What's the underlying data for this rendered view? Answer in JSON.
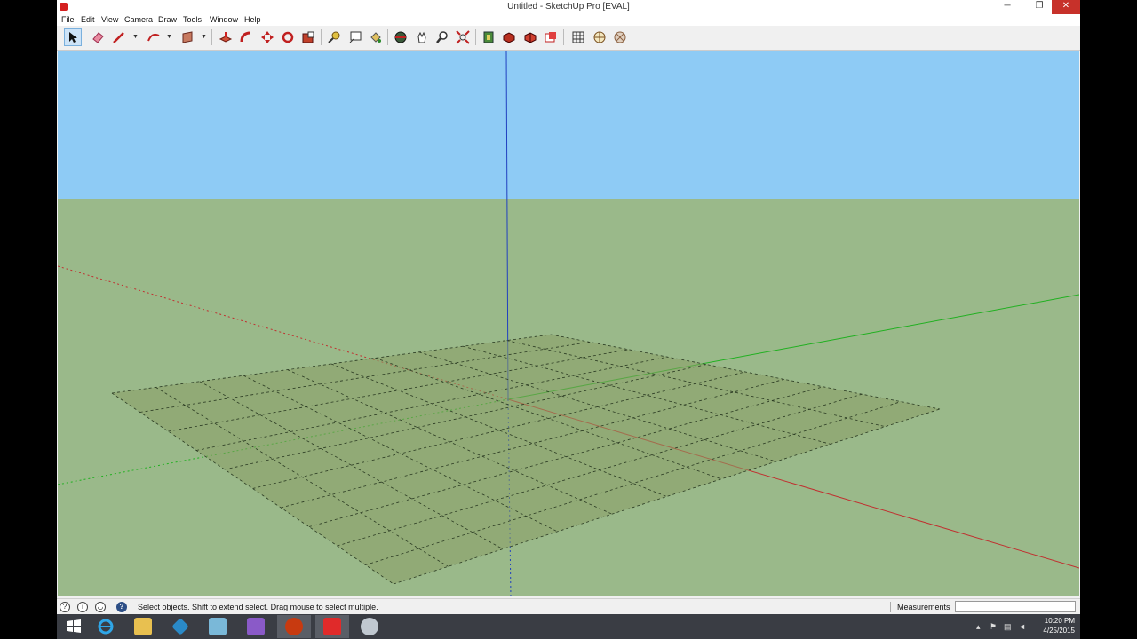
{
  "window": {
    "title": "Untitled - SketchUp Pro [EVAL]",
    "minimize_glyph": "─",
    "maximize_glyph": "❐",
    "close_glyph": "✕"
  },
  "menu": [
    "File",
    "Edit",
    "View",
    "Camera",
    "Draw",
    "Tools",
    "Window",
    "Help"
  ],
  "toolbar": {
    "tools": [
      "select-icon",
      "eraser-icon",
      "line-icon",
      "arc-icon",
      "rectangle-icon",
      "push-pull-icon",
      "follow-me-icon",
      "move-icon",
      "rotate-icon",
      "scale-icon",
      "tape-measure-icon",
      "text-icon",
      "paint-bucket-icon",
      "orbit-icon",
      "pan-icon",
      "zoom-icon",
      "zoom-extents-icon",
      "3d-warehouse-icon",
      "components-icon",
      "extension-warehouse-icon",
      "layout-icon",
      "grid-icon",
      "geo-location-icon",
      "photo-textures-icon"
    ],
    "active_tool": "select-icon"
  },
  "viewport": {
    "sky_color": "#8ecbf5",
    "ground_color": "#9ab98a",
    "red_axis": "#c03030",
    "green_axis": "#20b020",
    "blue_axis": "#2040c0"
  },
  "status": {
    "text": "Select objects. Shift to extend select. Drag mouse to select multiple.",
    "measurements_label": "Measurements",
    "measurements_value": ""
  },
  "taskbar": {
    "apps": [
      "start-icon",
      "internet-explorer-icon",
      "file-explorer-icon",
      "kodi-icon",
      "app-icon",
      "after-effects-icon",
      "browser-icon",
      "sketchup-icon",
      "paint-icon"
    ],
    "time": "10:20 PM",
    "date": "4/25/2015"
  }
}
